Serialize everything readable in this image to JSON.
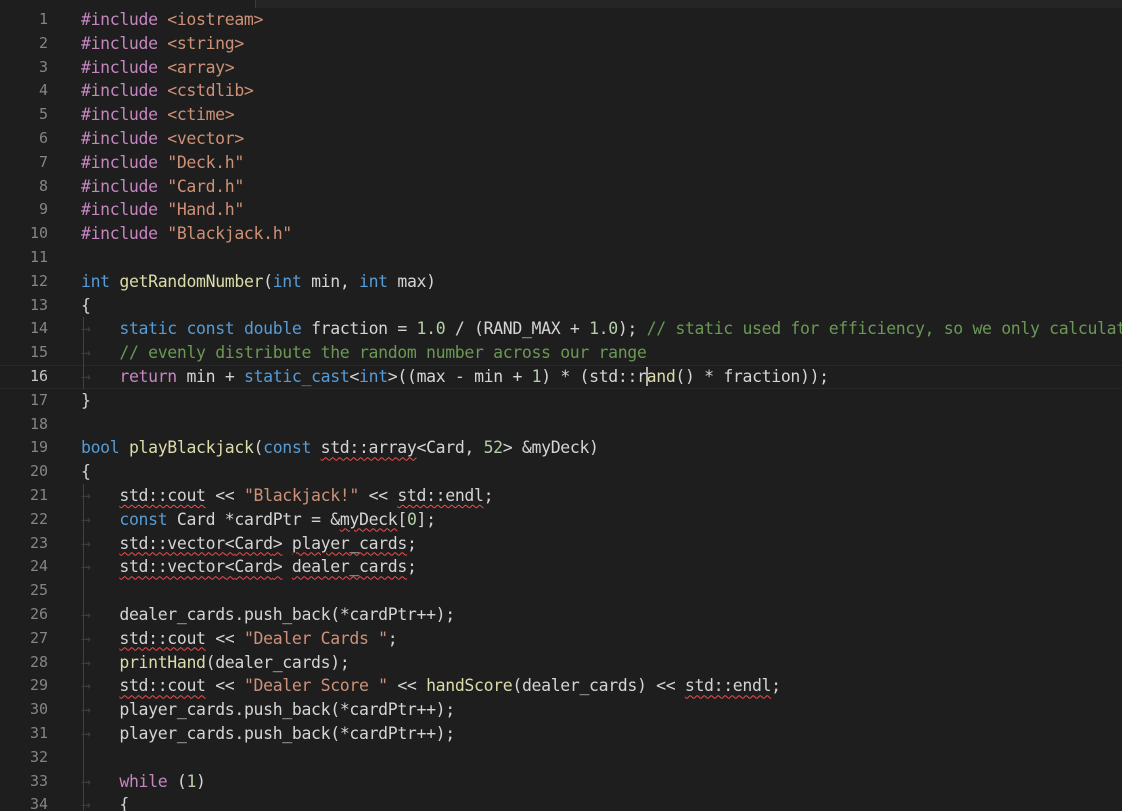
{
  "editor": {
    "active_line": "16",
    "line_numbers": [
      "1",
      "2",
      "3",
      "4",
      "5",
      "6",
      "7",
      "8",
      "9",
      "10",
      "11",
      "12",
      "13",
      "14",
      "15",
      "16",
      "17",
      "18",
      "19",
      "20",
      "21",
      "22",
      "23",
      "24",
      "25",
      "26",
      "27",
      "28",
      "29",
      "30",
      "31",
      "32",
      "33",
      "34"
    ],
    "tokens": {
      "include": "#include",
      "h_iostream": "<iostream>",
      "h_string": "<string>",
      "h_array": "<array>",
      "h_cstdlib": "<cstdlib>",
      "h_ctime": "<ctime>",
      "h_vector": "<vector>",
      "h_deck": "\"Deck.h\"",
      "h_card": "\"Card.h\"",
      "h_hand": "\"Hand.h\"",
      "h_blackjack": "\"Blackjack.h\"",
      "int": "int",
      "getRandomNumber": "getRandomNumber",
      "min": "min",
      "max": "max",
      "static": "static",
      "const": "const",
      "double": "double",
      "fraction": "fraction",
      "one_point_zero": "1.0",
      "rand_max": "RAND_MAX",
      "comment_14": "// static used for efficiency, so we only calculat",
      "comment_15": "// evenly distribute the random number across our range",
      "return": "return",
      "static_cast": "static_cast",
      "one": "1",
      "std_r": "std::r",
      "and": "and",
      "bool": "bool",
      "playBlackjack": "playBlackjack",
      "std_array": "std::array",
      "card": "Card",
      "fifty_two": "52",
      "myDeck": "myDeck",
      "std_cout": "std::cout",
      "str_blackjack": "\"Blackjack!\"",
      "std_endl": "std::endl",
      "cardPtr": "cardPtr",
      "zero": "0",
      "std_vector": "std::vector",
      "player_cards": "player_cards",
      "dealer_cards": "dealer_cards",
      "push_back": "push_back",
      "str_dealer_cards": "\"Dealer Cards \"",
      "printHand": "printHand",
      "str_dealer_score": "\"Dealer Score \"",
      "handScore": "handScore",
      "while": "while",
      "open_brace": "{",
      "close_brace": "}"
    }
  },
  "colors": {
    "background": "#1e1e1e",
    "preprocessor": "#c586c0",
    "string": "#ce9178",
    "keyword": "#569cd6",
    "type": "#4ec9b0",
    "function": "#dcdcaa",
    "number": "#b5cea8",
    "comment": "#6a9955",
    "squiggle": "#f14c4c"
  }
}
